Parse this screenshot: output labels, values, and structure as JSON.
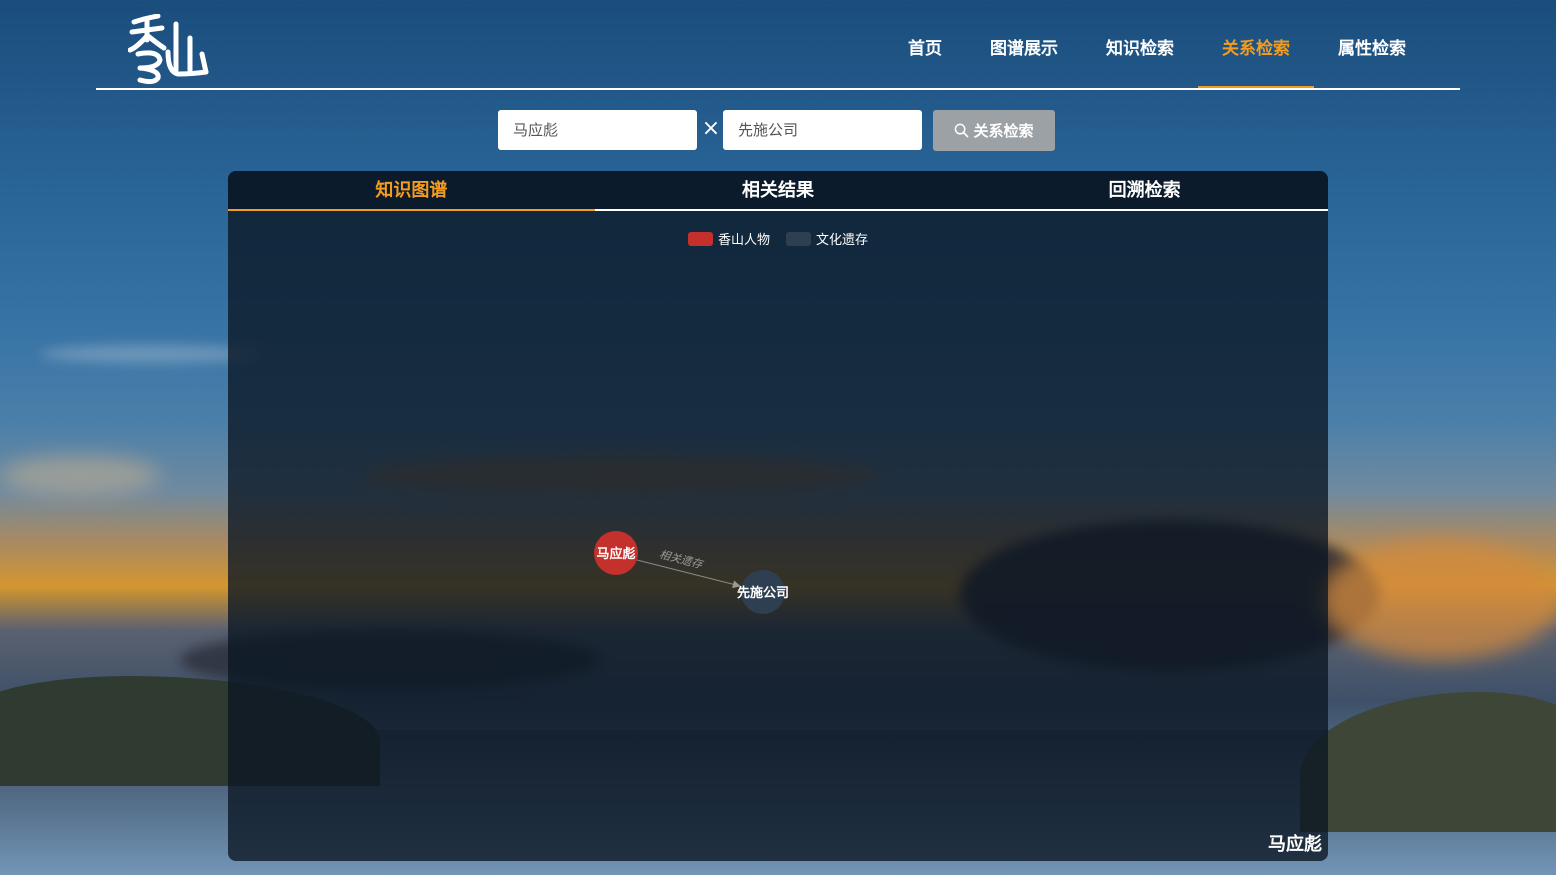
{
  "nav": {
    "items": [
      "首页",
      "图谱展示",
      "知识检索",
      "关系检索",
      "属性检索"
    ],
    "active_index": 3
  },
  "search": {
    "entity1_value": "马应彪",
    "entity2_value": "先施公司",
    "separator": "×",
    "button_label": "关系检索"
  },
  "panel": {
    "tabs": [
      "知识图谱",
      "相关结果",
      "回溯检索"
    ],
    "active_tab": 0,
    "legend": [
      {
        "label": "香山人物",
        "color": "#c4302b"
      },
      {
        "label": "文化遗存",
        "color": "#2e3f52"
      }
    ],
    "graph": {
      "nodes": [
        {
          "name": "马应彪",
          "category": "香山人物"
        },
        {
          "name": "先施公司",
          "category": "文化遗存"
        }
      ],
      "links": [
        {
          "source": "马应彪",
          "target": "先施公司",
          "label": "相关遗存"
        }
      ]
    },
    "corner_label": "马应彪"
  },
  "colors": {
    "accent": "#f39c1f",
    "person_node": "#c4302b",
    "heritage_node": "#2e3f52"
  }
}
